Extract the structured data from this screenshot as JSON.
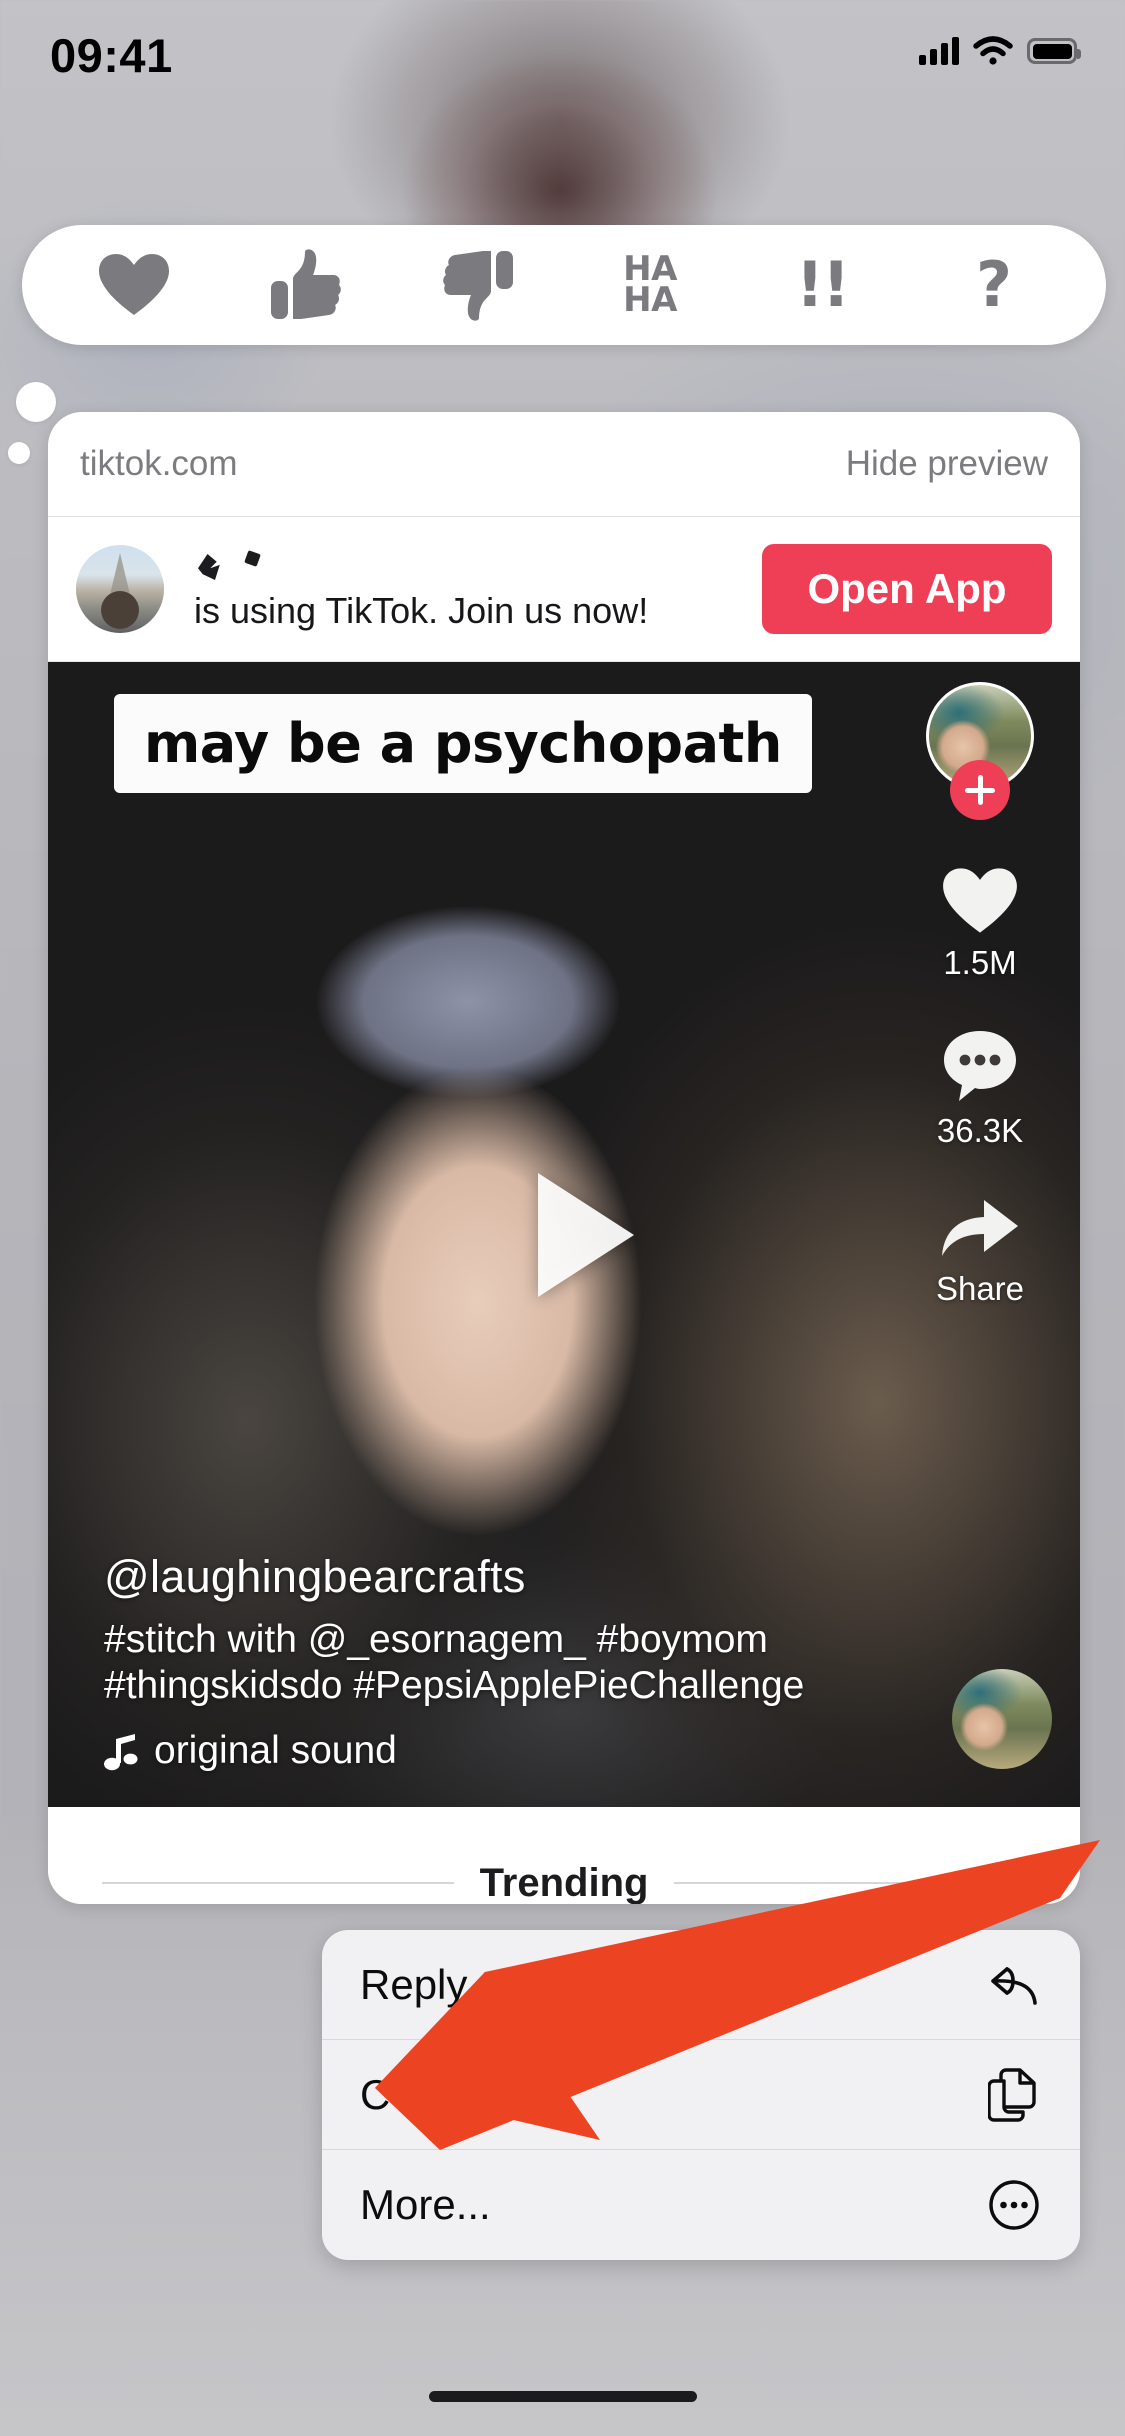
{
  "status_bar": {
    "time": "09:41",
    "icons": [
      "cellular-signal-icon",
      "wifi-icon",
      "battery-icon"
    ]
  },
  "reaction_bar": {
    "reactions": [
      {
        "name": "heart-reaction",
        "label": "Heart"
      },
      {
        "name": "thumbs-up-reaction",
        "label": "Thumbs Up"
      },
      {
        "name": "thumbs-down-reaction",
        "label": "Thumbs Down"
      },
      {
        "name": "haha-reaction",
        "label_line1": "HA",
        "label_line2": "HA"
      },
      {
        "name": "exclamation-reaction",
        "label": "!!"
      },
      {
        "name": "question-reaction",
        "label": "?"
      }
    ]
  },
  "preview_card": {
    "domain": "tiktok.com",
    "hide_preview_label": "Hide preview",
    "app_banner": {
      "username": "",
      "text": "is using TikTok. Join us now!",
      "button_label": "Open App",
      "button_color": "#ef3f57"
    },
    "video": {
      "caption_overlay": "may be a psychopath",
      "handle": "@laughingbearcrafts",
      "description_line1": "#stitch with @_esornagem_ #boymom",
      "description_line2": "#thingskidsdo #PepsiApplePieChallenge",
      "sound": "original sound",
      "sound_icon": "music-note-icon",
      "actions": [
        {
          "name": "like-button",
          "icon": "heart-icon",
          "count": "1.5M"
        },
        {
          "name": "comment-button",
          "icon": "comment-bubble-icon",
          "count": "36.3K"
        },
        {
          "name": "share-button",
          "icon": "share-arrow-icon",
          "count": "Share"
        }
      ],
      "follow_button": "+"
    },
    "trending_label": "Trending"
  },
  "context_menu": {
    "items": [
      {
        "label": "Reply",
        "icon": "reply-arrow-icon",
        "name": "menu-item-reply"
      },
      {
        "label": "Copy",
        "icon": "copy-icon",
        "name": "menu-item-copy"
      },
      {
        "label": "More...",
        "icon": "ellipsis-circle-icon",
        "name": "menu-item-more"
      }
    ]
  },
  "annotation": {
    "arrow_color": "#ec4323",
    "points_at": "Copy"
  }
}
